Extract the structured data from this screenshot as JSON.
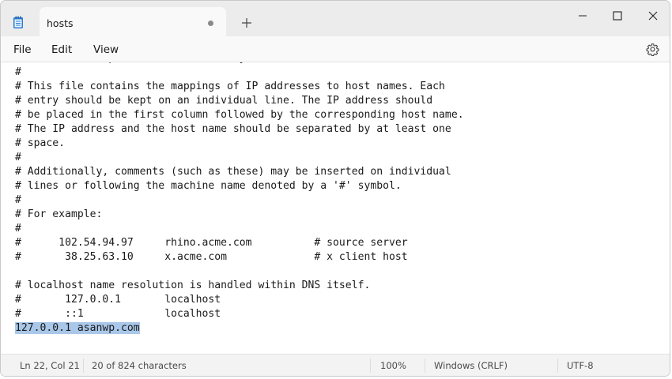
{
  "tab": {
    "title": "hosts"
  },
  "menu": {
    "file": "File",
    "edit": "Edit",
    "view": "View"
  },
  "icons": {
    "app": "notepad-icon",
    "new_tab": "plus-icon",
    "minimize": "minimize-icon",
    "maximize": "maximize-icon",
    "close": "close-icon",
    "settings": "gear-icon",
    "unsaved": "unsaved-dot-icon"
  },
  "editor": {
    "lines": [
      "# This is a sample HOSTS file used by Microsoft TCP/IP for Windows.",
      "#",
      "# This file contains the mappings of IP addresses to host names. Each",
      "# entry should be kept on an individual line. The IP address should",
      "# be placed in the first column followed by the corresponding host name.",
      "# The IP address and the host name should be separated by at least one",
      "# space.",
      "#",
      "# Additionally, comments (such as these) may be inserted on individual",
      "# lines or following the machine name denoted by a '#' symbol.",
      "#",
      "# For example:",
      "#",
      "#      102.54.94.97     rhino.acme.com          # source server",
      "#       38.25.63.10     x.acme.com              # x client host",
      "",
      "# localhost name resolution is handled within DNS itself.",
      "#       127.0.0.1       localhost",
      "#       ::1             localhost",
      "127.0.0.1 asanwp.com"
    ],
    "selected_line_index": 19
  },
  "status": {
    "position": "Ln 22, Col 21",
    "chars": "20 of 824 characters",
    "zoom": "100%",
    "line_ending": "Windows (CRLF)",
    "encoding": "UTF-8"
  },
  "colors": {
    "titlebar": "#ececec",
    "tab": "#f9f9f9",
    "selection": "#a9c7e8",
    "statusbar": "#f3f3f3"
  }
}
